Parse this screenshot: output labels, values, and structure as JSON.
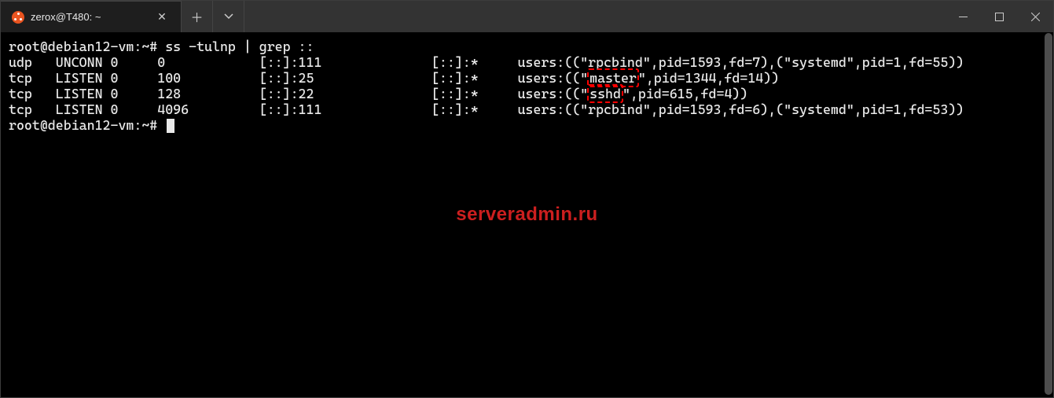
{
  "window": {
    "tab_title": "zerox@T480: ~",
    "watermark": "serveradmin.ru"
  },
  "prompt": "root@debian12-vm:~#",
  "command": "ss -tulnp | grep ::",
  "columns_order": [
    "proto",
    "state",
    "recvq",
    "sendq",
    "local",
    "peer",
    "users"
  ],
  "rows": [
    {
      "proto": "udp",
      "state": "UNCONN",
      "recvq": "0",
      "sendq": "0",
      "local": "[::]:111",
      "peer": "[::]:*",
      "users": "users:((\"rpcbind\",pid=1593,fd=7),(\"systemd\",pid=1,fd=55))",
      "highlight": null
    },
    {
      "proto": "tcp",
      "state": "LISTEN",
      "recvq": "0",
      "sendq": "100",
      "local": "[::]:25",
      "peer": "[::]:*",
      "users": "users:((\"master\",pid=1344,fd=14))",
      "highlight": "master"
    },
    {
      "proto": "tcp",
      "state": "LISTEN",
      "recvq": "0",
      "sendq": "128",
      "local": "[::]:22",
      "peer": "[::]:*",
      "users": "users:((\"sshd\",pid=615,fd=4))",
      "highlight": "sshd"
    },
    {
      "proto": "tcp",
      "state": "LISTEN",
      "recvq": "0",
      "sendq": "4096",
      "local": "[::]:111",
      "peer": "[::]:*",
      "users": "users:((\"rpcbind\",pid=1593,fd=6),(\"systemd\",pid=1,fd=53))",
      "highlight": null
    }
  ],
  "colwidths": {
    "proto": 6,
    "state": 7,
    "recvq": 6,
    "sendq": 13,
    "local": 22,
    "peer": 11
  }
}
